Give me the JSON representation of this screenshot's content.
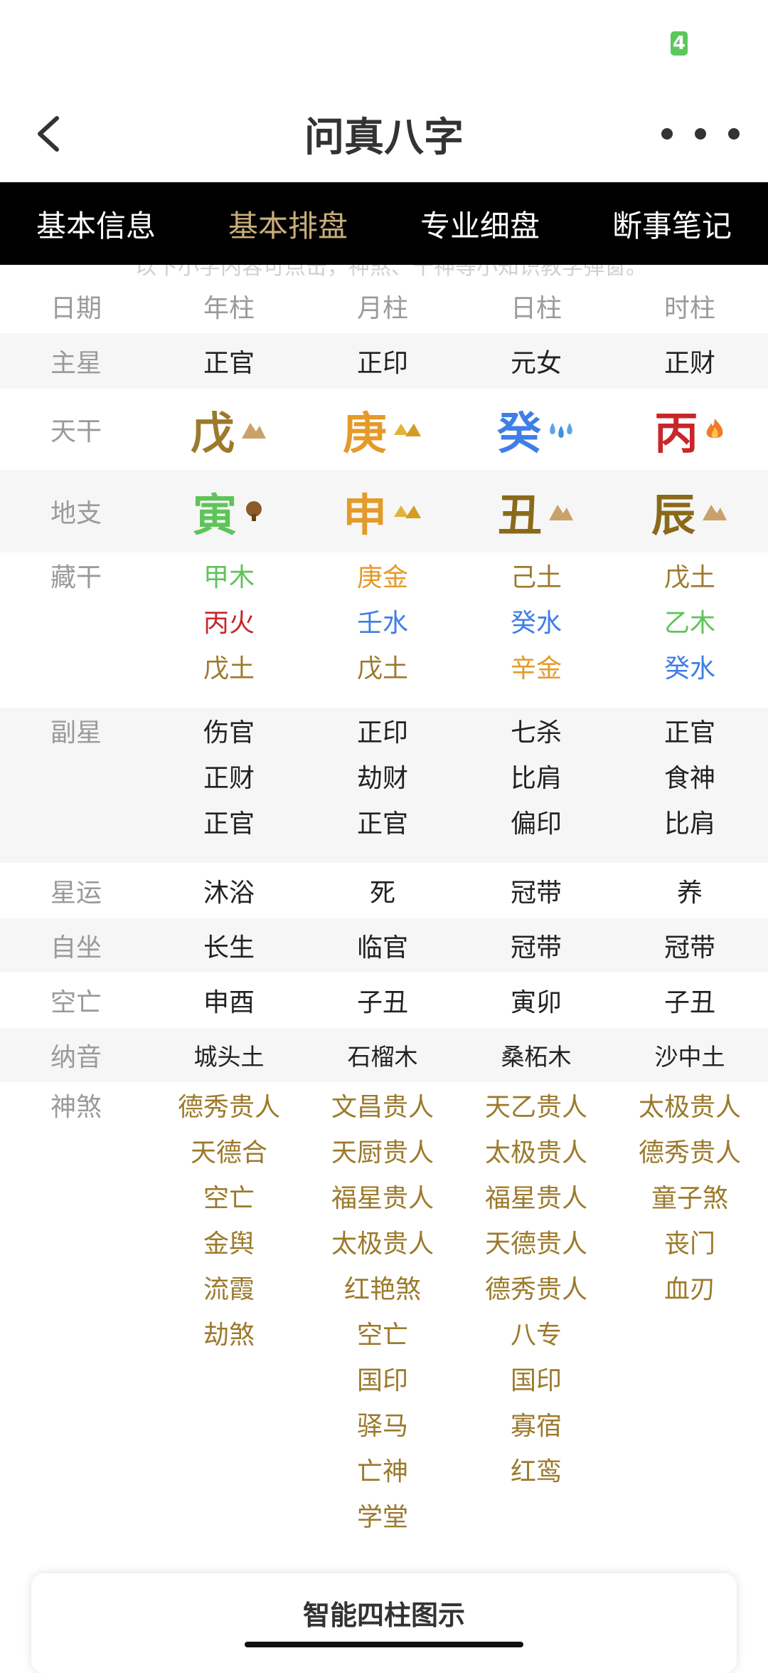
{
  "status": {
    "battery": "4"
  },
  "header": {
    "title": "问真八字"
  },
  "tabs": [
    {
      "label": "基本信息"
    },
    {
      "label": "基本排盘"
    },
    {
      "label": "专业细盘"
    },
    {
      "label": "断事笔记"
    }
  ],
  "notice": "以下小字内容可点击，神煞、十神等小知识教学弹窗。",
  "columns": {
    "label": "日期",
    "c": [
      "年柱",
      "月柱",
      "日柱",
      "时柱"
    ]
  },
  "zhuxing": {
    "label": "主星",
    "c": [
      "正官",
      "正印",
      "元女",
      "正财"
    ]
  },
  "tiangan": {
    "label": "天干",
    "c": [
      "戊",
      "庚",
      "癸",
      "丙"
    ]
  },
  "dizhi": {
    "label": "地支",
    "c": [
      "寅",
      "申",
      "丑",
      "辰"
    ]
  },
  "canggan": {
    "label": "藏干",
    "c": [
      [
        "甲木",
        "丙火",
        "戊土"
      ],
      [
        "庚金",
        "壬水",
        "戊土"
      ],
      [
        "己土",
        "癸水",
        "辛金"
      ],
      [
        "戊土",
        "乙木",
        "癸水"
      ]
    ]
  },
  "fuxing": {
    "label": "副星",
    "c": [
      [
        "伤官",
        "正财",
        "正官"
      ],
      [
        "正印",
        "劫财",
        "正官"
      ],
      [
        "七杀",
        "比肩",
        "偏印"
      ],
      [
        "正官",
        "食神",
        "比肩"
      ]
    ]
  },
  "xingyun": {
    "label": "星运",
    "c": [
      "沐浴",
      "死",
      "冠带",
      "养"
    ]
  },
  "zizuo": {
    "label": "自坐",
    "c": [
      "长生",
      "临官",
      "冠带",
      "冠带"
    ]
  },
  "kongwang": {
    "label": "空亡",
    "c": [
      "申酉",
      "子丑",
      "寅卯",
      "子丑"
    ]
  },
  "nayin": {
    "label": "纳音",
    "c": [
      "城头土",
      "石榴木",
      "桑柘木",
      "沙中土"
    ]
  },
  "shensha": {
    "label": "神煞",
    "c": [
      [
        "德秀贵人",
        "天德合",
        "空亡",
        "金舆",
        "流霞",
        "劫煞"
      ],
      [
        "文昌贵人",
        "天厨贵人",
        "福星贵人",
        "太极贵人",
        "红艳煞",
        "空亡",
        "国印",
        "驿马",
        "亡神",
        "学堂"
      ],
      [
        "天乙贵人",
        "太极贵人",
        "福星贵人",
        "天德贵人",
        "德秀贵人",
        "八专",
        "国印",
        "寡宿",
        "红鸾"
      ],
      [
        "太极贵人",
        "德秀贵人",
        "童子煞",
        "丧门",
        "血刃"
      ]
    ]
  },
  "card": {
    "title": "智能四柱图示"
  },
  "colors": {
    "tab_active": "#c7ad7a",
    "shensha": "#9c7a2c",
    "earth": "#9c7a2c",
    "metal": "#e49a2a",
    "water": "#3f7ee6",
    "fire": "#c8262a",
    "wood": "#5ec45a"
  }
}
